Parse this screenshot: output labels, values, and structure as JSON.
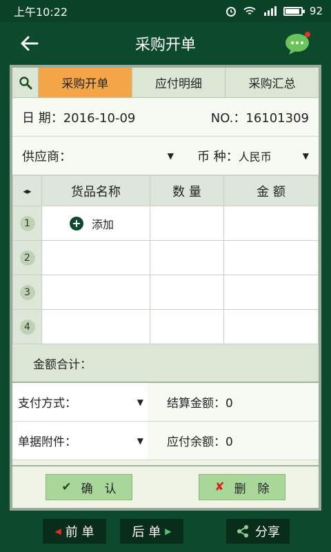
{
  "status": {
    "time": "上午10:22",
    "battery": "92",
    "battery_fraction": 0.92
  },
  "header": {
    "title": "采购开单"
  },
  "tabs": [
    {
      "label": "采购开单",
      "active": true
    },
    {
      "label": "应付明细",
      "active": false
    },
    {
      "label": "采购汇总",
      "active": false
    }
  ],
  "form": {
    "date_label": "日 期：",
    "date_value": "2016-10-09",
    "no_label": "NO.：",
    "no_value": "16101309",
    "supplier_label": "供应商：",
    "currency_label": "币 种：",
    "currency_value": "人民币"
  },
  "table": {
    "arrow_glyph": "◂▸",
    "columns": [
      "货品名称",
      "数 量",
      "金 额"
    ],
    "rows": [
      {
        "index": "1",
        "name": "添加"
      },
      {
        "index": "2",
        "name": ""
      },
      {
        "index": "3",
        "name": ""
      },
      {
        "index": "4",
        "name": ""
      }
    ]
  },
  "summary": {
    "total_label": "金额合计：",
    "payment_label": "支付方式：",
    "settle_label": "结算金额：",
    "settle_value": "0",
    "attachment_label": "单据附件：",
    "balance_label": "应付余额：",
    "balance_value": "0"
  },
  "actions": {
    "confirm": "确　认",
    "delete": "删　除"
  },
  "bottom": {
    "prev": "前 单",
    "next": "后 单",
    "share": "分享"
  },
  "colors": {
    "primary": "#0d4a2c",
    "active_tab": "#f4a547",
    "button": "#a9d79a",
    "delete_icon": "#d6221c"
  },
  "icons": {
    "back": "arrow-left-icon",
    "chat": "chat-bubble-icon",
    "search": "search-icon",
    "add": "plus-circle-icon",
    "share": "share-icon"
  }
}
